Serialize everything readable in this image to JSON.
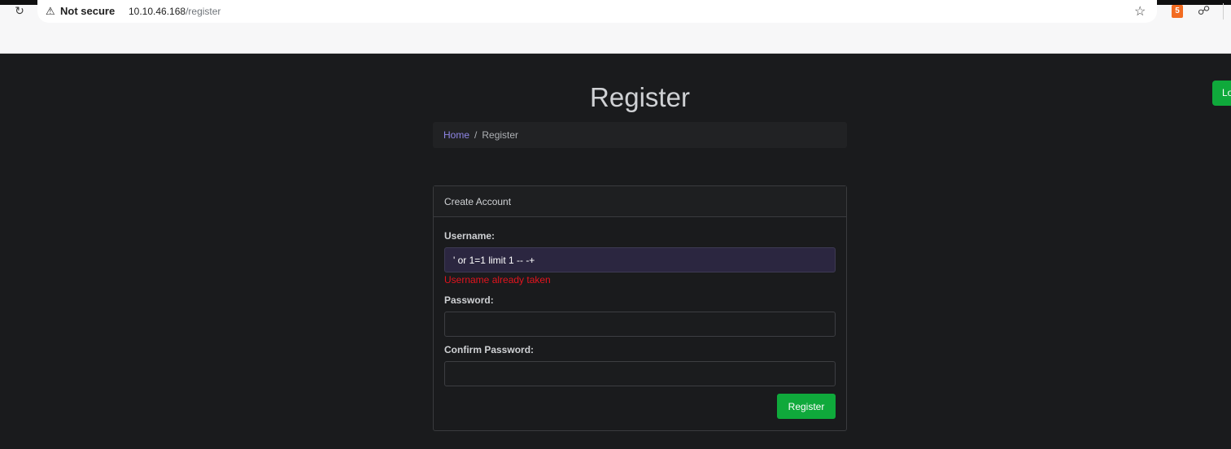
{
  "browser": {
    "security_label": "Not secure",
    "url_host": "10.10.46.168",
    "url_path": "/register",
    "extension_badge": "5"
  },
  "header": {
    "login_label": "Login"
  },
  "page": {
    "title": "Register",
    "breadcrumb": {
      "home": "Home",
      "separator": "/",
      "current": "Register"
    }
  },
  "form": {
    "card_title": "Create Account",
    "username_label": "Username:",
    "username_value": "' or 1=1 limit 1 -- -+",
    "username_error": "Username already taken",
    "password_label": "Password:",
    "password_value": "",
    "confirm_label": "Confirm Password:",
    "confirm_value": "",
    "submit_label": "Register"
  },
  "colors": {
    "accent": "#0fa93b",
    "link": "#8f86e6",
    "error": "#e3141e",
    "background": "#1a1b1d"
  }
}
